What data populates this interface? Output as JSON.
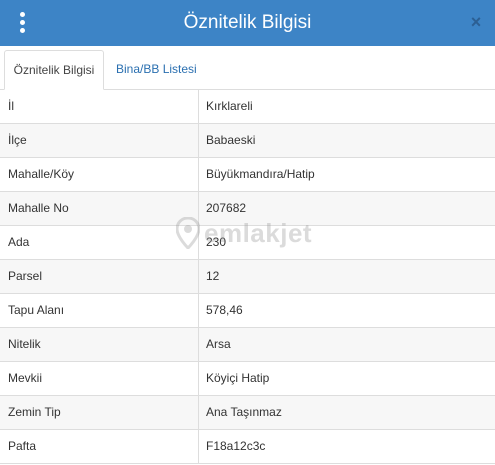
{
  "header": {
    "title": "Öznitelik Bilgisi",
    "close_label": "×"
  },
  "tabs": [
    {
      "label": "Öznitelik Bilgisi",
      "active": true
    },
    {
      "label": "Bina/BB Listesi",
      "active": false
    }
  ],
  "rows": [
    {
      "key": "İl",
      "value": "Kırklareli"
    },
    {
      "key": "İlçe",
      "value": "Babaeski"
    },
    {
      "key": "Mahalle/Köy",
      "value": "Büyükmandıra/Hatip"
    },
    {
      "key": "Mahalle No",
      "value": "207682"
    },
    {
      "key": "Ada",
      "value": "230"
    },
    {
      "key": "Parsel",
      "value": "12"
    },
    {
      "key": "Tapu Alanı",
      "value": "578,46"
    },
    {
      "key": "Nitelik",
      "value": "Arsa"
    },
    {
      "key": "Mevkii",
      "value": "Köyiçi Hatip"
    },
    {
      "key": "Zemin Tip",
      "value": "Ana Taşınmaz"
    },
    {
      "key": "Pafta",
      "value": "F18a12c3c"
    }
  ],
  "watermark": {
    "text": "emlakjet"
  },
  "colors": {
    "header": "#3d84c6",
    "link": "#2a6fb0",
    "border": "#dddddd"
  },
  "icons": {
    "menu": "kebab-menu-icon",
    "close": "close-icon",
    "watermark": "location-pin-icon"
  }
}
